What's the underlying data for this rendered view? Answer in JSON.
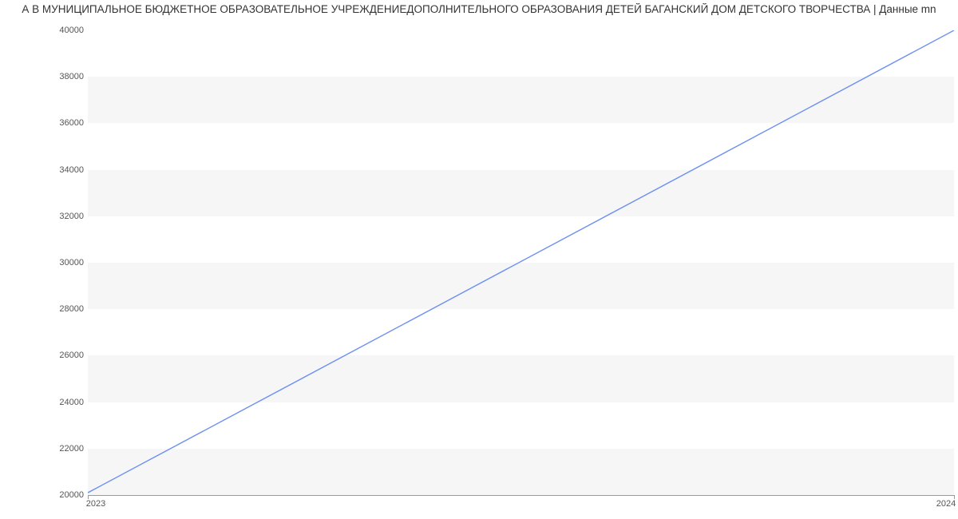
{
  "chart_data": {
    "type": "line",
    "title": "А В МУНИЦИПАЛЬНОЕ БЮДЖЕТНОЕ ОБРАЗОВАТЕЛЬНОЕ УЧРЕЖДЕНИЕДОПОЛНИТЕЛЬНОГО ОБРАЗОВАНИЯ ДЕТЕЙ БАГАНСКИЙ ДОМ ДЕТСКОГО ТВОРЧЕСТВА | Данные mn",
    "x": [
      2023,
      2024
    ],
    "values": [
      20100,
      40000
    ],
    "xlim": [
      2023,
      2024
    ],
    "ylim": [
      20000,
      40000
    ],
    "y_ticks": [
      20000,
      22000,
      24000,
      26000,
      28000,
      30000,
      32000,
      34000,
      36000,
      38000,
      40000
    ],
    "x_ticks": [
      2023,
      2024
    ],
    "line_color": "#6b8ff2"
  }
}
